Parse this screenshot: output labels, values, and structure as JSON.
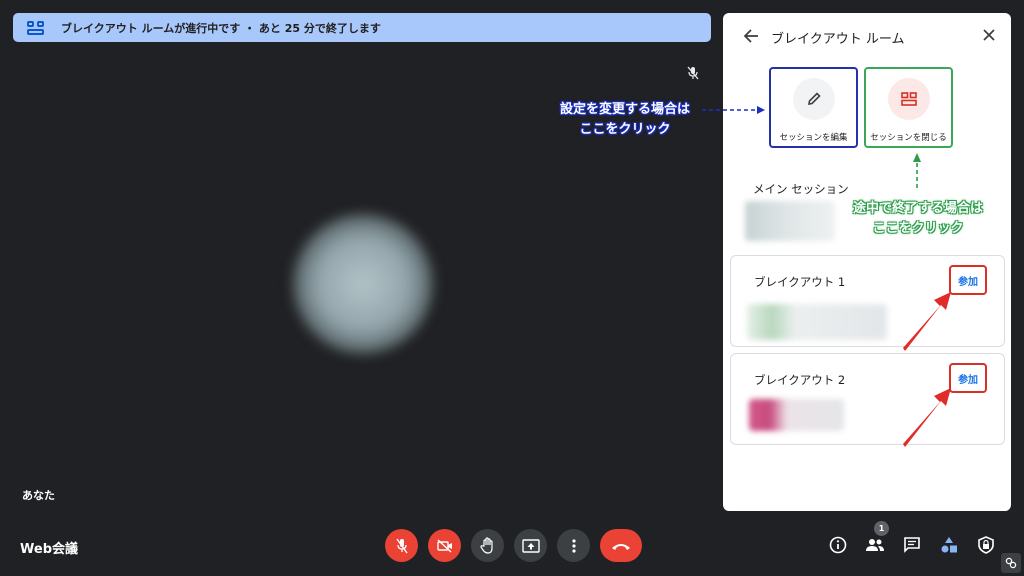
{
  "banner": {
    "text": "ブレイクアウト ルームが進行中です ・ あと 25 分で終了します"
  },
  "stage": {
    "self_label": "あなた",
    "meeting_name": "Web会議"
  },
  "controls": {
    "items": [
      "mic-off",
      "camera-off",
      "raise-hand",
      "present",
      "more-options",
      "leave-call"
    ],
    "participants_count": "1"
  },
  "panel": {
    "title": "ブレイクアウト ルーム",
    "edit_label": "セッションを編集",
    "close_label": "セッションを閉じる",
    "main_session_title": "メイン セッション",
    "rooms": [
      {
        "name": "ブレイクアウト 1",
        "join_label": "参加"
      },
      {
        "name": "ブレイクアウト 2",
        "join_label": "参加"
      }
    ]
  },
  "annotations": {
    "blue_line1": "設定を変更する場合は",
    "blue_line2": "ここをクリック",
    "green_line1": "途中で終了する場合は",
    "green_line2": "ここをクリック"
  },
  "colors": {
    "banner_bg": "#a8c7fa",
    "stage_bg": "#202124",
    "danger": "#ea4335",
    "annotation_blue": "#1a2fbf",
    "annotation_green": "#2a9d4a",
    "join_border": "#d93025"
  }
}
